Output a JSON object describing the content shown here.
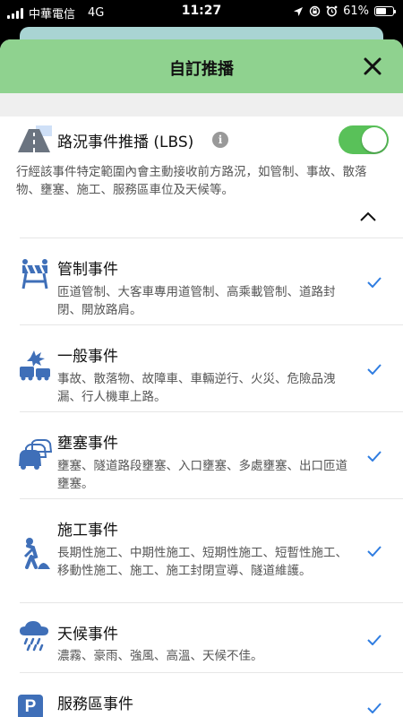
{
  "status": {
    "carrier": "中華電信",
    "network": "4G",
    "time": "11:27",
    "battery_pct": "61%",
    "battery_level": 0.61
  },
  "header": {
    "title": "自訂推播"
  },
  "lbs": {
    "title": "路況事件推播 (LBS)",
    "info_glyph": "i",
    "enabled": true,
    "description": "行經該事件特定範圍內會主動接收前方路況，如管制、事故、散落物、壅塞、施工、服務區車位及天候等。"
  },
  "categories": [
    {
      "icon": "barricade-icon",
      "title": "管制事件",
      "description": "匝道管制、大客車專用道管制、高乘載管制、道路封閉、開放路肩。",
      "checked": true
    },
    {
      "icon": "car-accident-icon",
      "title": "一般事件",
      "description": "事故、散落物、故障車、車輛逆行、火災、危險品洩漏、行人機車上路。",
      "checked": true
    },
    {
      "icon": "traffic-jam-icon",
      "title": "壅塞事件",
      "description": "壅塞、隧道路段壅塞、入口壅塞、多處壅塞、出口匝道壅塞。",
      "checked": true
    },
    {
      "icon": "roadwork-icon",
      "title": "施工事件",
      "description": "長期性施工、中期性施工、短期性施工、短暫性施工、移動性施工、施工、施工封閉宣導、隧道維護。",
      "checked": true
    },
    {
      "icon": "weather-icon",
      "title": "天候事件",
      "description": "濃霧、豪雨、強風、高溫、天候不佳。",
      "checked": true
    },
    {
      "icon": "parking-icon",
      "title": "服務區事件",
      "icon_glyph": "P",
      "description": "",
      "checked": true
    }
  ],
  "colors": {
    "header_bg": "#8fd28f",
    "toggle_on": "#59c159",
    "icon_blue": "#3f6fb8",
    "check_blue": "#2f7de1"
  }
}
